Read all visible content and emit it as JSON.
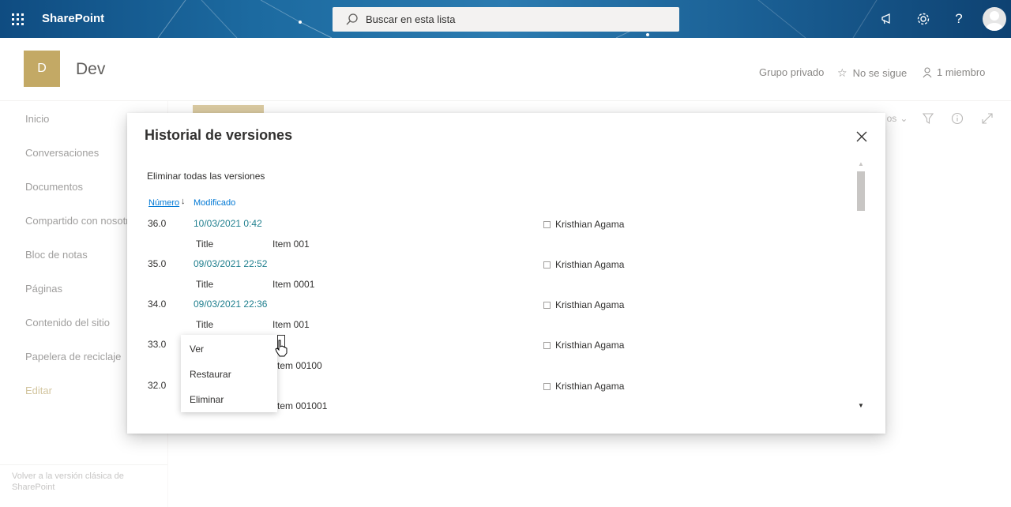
{
  "suitebar": {
    "brand": "SharePoint",
    "search_placeholder": "Buscar en esta lista"
  },
  "site": {
    "logo_letter": "D",
    "title": "Dev",
    "privacy": "Grupo privado",
    "follow": "No se sigue",
    "members": "1 miembro"
  },
  "nav": {
    "items": [
      "Inicio",
      "Conversaciones",
      "Documentos",
      "Compartido con nosotros",
      "Bloc de notas",
      "Páginas",
      "Contenido del sitio",
      "Papelera de reciclaje"
    ],
    "edit": "Editar",
    "classic": "Volver a la versión clásica de SharePoint"
  },
  "background": {
    "partial_label": "os"
  },
  "dialog": {
    "title": "Historial de versiones",
    "delete_all": "Eliminar todas las versiones",
    "col_number": "Número",
    "col_modified": "Modificado",
    "versions": [
      {
        "number": "36.0",
        "date": "10/03/2021 0:42",
        "author": "Kristhian Agama",
        "field": "Title",
        "value": "Item 001"
      },
      {
        "number": "35.0",
        "date": "09/03/2021 22:52",
        "author": "Kristhian Agama",
        "field": "Title",
        "value": "Item 0001"
      },
      {
        "number": "34.0",
        "date": "09/03/2021 22:36",
        "author": "Kristhian Agama",
        "field": "Title",
        "value": "Item 001"
      },
      {
        "number": "33.0",
        "date": "",
        "author": "Kristhian Agama",
        "field": "",
        "value": "tem 00100"
      },
      {
        "number": "32.0",
        "date": "",
        "author": "Kristhian Agama",
        "field": "",
        "value": "tem 001001"
      }
    ]
  },
  "context_menu": {
    "items": [
      "Ver",
      "Restaurar",
      "Eliminar"
    ]
  },
  "colors": {
    "accent": "#c3a965",
    "link": "#1f7f8e",
    "suitebar": "#1c6aa0"
  }
}
